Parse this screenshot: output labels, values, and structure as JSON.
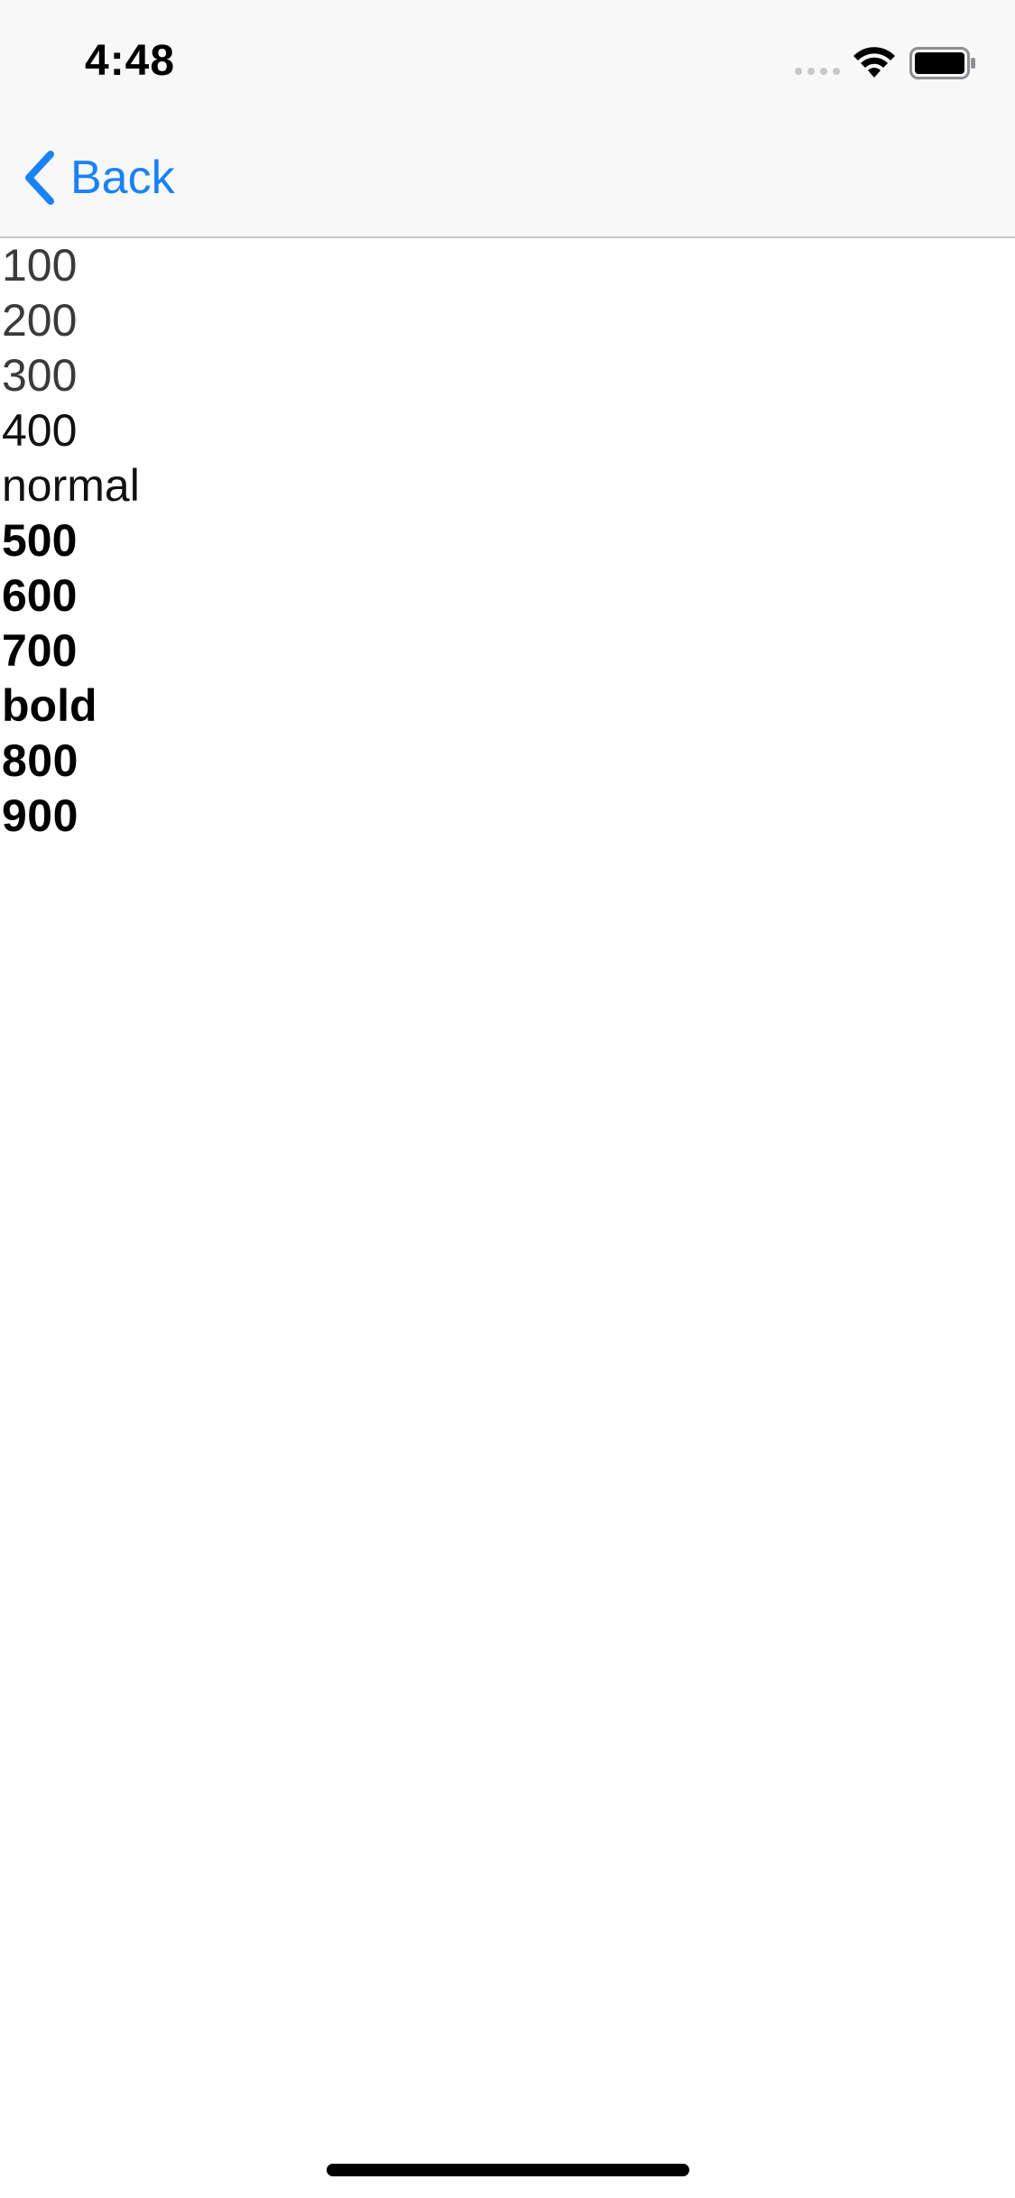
{
  "status_bar": {
    "time": "4:48",
    "icons": [
      "signal-dots-icon",
      "wifi-icon",
      "battery-icon"
    ]
  },
  "nav": {
    "back_label": "Back",
    "accent_color": "#1a82f7"
  },
  "weights": [
    {
      "label": "100",
      "style": "light"
    },
    {
      "label": "200",
      "style": "light"
    },
    {
      "label": "300",
      "style": "light"
    },
    {
      "label": "400",
      "style": "regular"
    },
    {
      "label": "normal",
      "style": "regular"
    },
    {
      "label": "500",
      "style": "bold"
    },
    {
      "label": "600",
      "style": "bold"
    },
    {
      "label": "700",
      "style": "bold"
    },
    {
      "label": "bold",
      "style": "bold"
    },
    {
      "label": "800",
      "style": "heavy"
    },
    {
      "label": "900",
      "style": "heavy"
    }
  ]
}
